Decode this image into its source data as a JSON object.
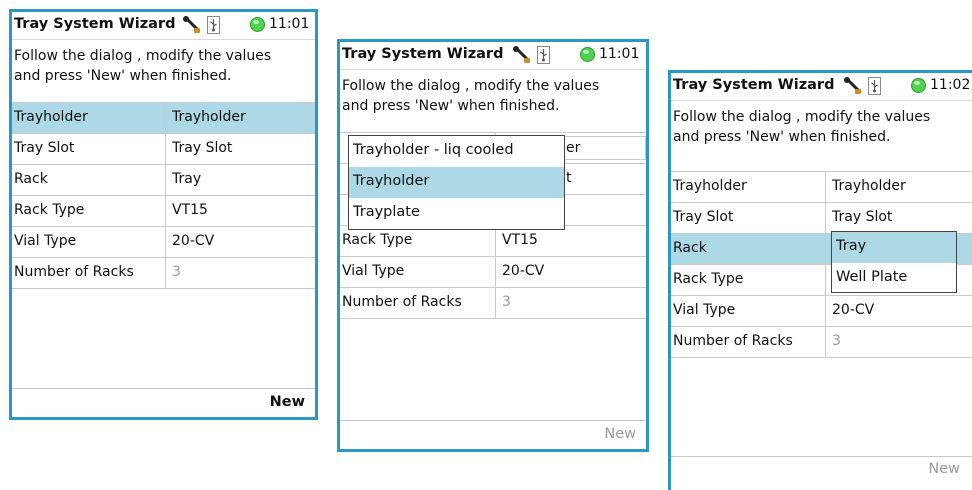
{
  "colors": {
    "frame": "#2b97c6",
    "selection": "#add8e6",
    "status_led": "#4fd24f",
    "disabled_text": "#9a9a9a"
  },
  "common": {
    "title": "Tray System Wizard",
    "instructions": "Follow the dialog , modify the values\nand press 'New' when finished.",
    "new_label": "New",
    "icons": [
      "wrench-icon",
      "usb-icon",
      "status-led-icon"
    ]
  },
  "window1": {
    "time": "11:01",
    "rows": [
      {
        "label": "Trayholder",
        "value": "Trayholder"
      },
      {
        "label": "Tray Slot",
        "value": "Tray Slot"
      },
      {
        "label": "Rack",
        "value": "Tray"
      },
      {
        "label": "Rack Type",
        "value": "VT15"
      },
      {
        "label": "Vial Type",
        "value": "20-CV"
      },
      {
        "label": "Number of Racks",
        "value": "3"
      }
    ]
  },
  "window2": {
    "time": "11:01",
    "rows": [
      {
        "label": "",
        "value": ""
      },
      {
        "label": "",
        "value": ""
      },
      {
        "label": "",
        "value": ""
      },
      {
        "label": "Rack Type",
        "value": "VT15"
      },
      {
        "label": "Vial Type",
        "value": "20-CV"
      },
      {
        "label": "Number of Racks",
        "value": "3"
      }
    ],
    "partial_edit_text": "er",
    "partial_row2_text": "t",
    "dropdown_options": [
      "Trayholder - liq cooled",
      "Trayholder",
      "Trayplate"
    ]
  },
  "window3": {
    "time": "11:02",
    "rows": [
      {
        "label": "Trayholder",
        "value": "Trayholder"
      },
      {
        "label": "Tray Slot",
        "value": "Tray Slot"
      },
      {
        "label": "Rack",
        "value": ""
      },
      {
        "label": "Rack Type",
        "value": ""
      },
      {
        "label": "Vial Type",
        "value": "20-CV"
      },
      {
        "label": "Number of Racks",
        "value": "3"
      }
    ],
    "dropdown_options": [
      "Tray",
      "Well Plate"
    ]
  }
}
